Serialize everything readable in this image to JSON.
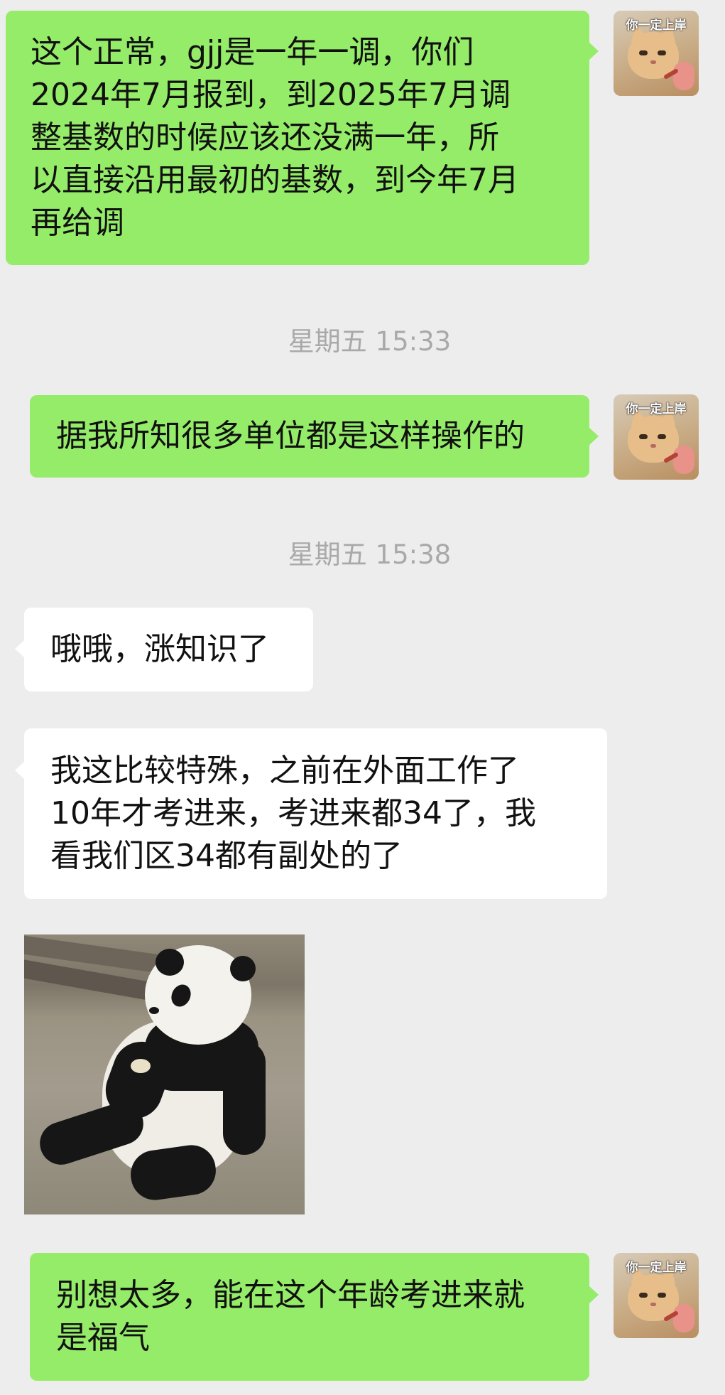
{
  "messages": [
    {
      "sender": "me",
      "lines": [
        "这个正常，gjj是一年一调，你们",
        "2024年7月报到，到2025年7月调",
        "整基数的时候应该还没满一年，所",
        "以直接沿用最初的基数，到今年7月",
        "再给调"
      ]
    },
    {
      "type": "time",
      "text": "星期五 15:33"
    },
    {
      "sender": "me",
      "lines": [
        "据我所知很多单位都是这样操作的"
      ]
    },
    {
      "type": "time",
      "text": "星期五 15:38"
    },
    {
      "sender": "other",
      "lines": [
        "哦哦，涨知识了"
      ]
    },
    {
      "sender": "other",
      "lines": [
        "我这比较特殊，之前在外面工作了",
        "10年才考进来，考进来都34了，我",
        "看我们区34都有副处的了"
      ]
    },
    {
      "sender": "other",
      "type": "sticker",
      "sticker_name": "panda-sticker"
    },
    {
      "sender": "me",
      "lines": [
        "别想太多，能在这个年龄考进来就",
        "是福气"
      ]
    }
  ],
  "avatar": {
    "text": "你一定上岸",
    "icon": "cat-pointing-avatar"
  },
  "colors": {
    "background": "#EDEDED",
    "my_bubble": "#95EC69",
    "other_bubble": "#FFFFFF",
    "timestamp": "#A9A9A9"
  }
}
